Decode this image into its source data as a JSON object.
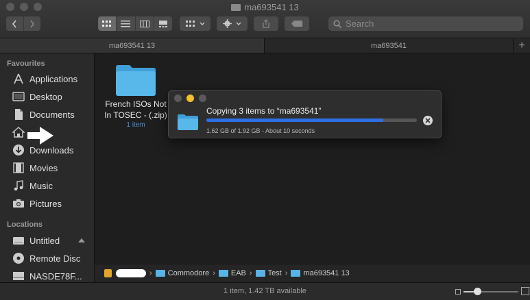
{
  "window": {
    "title": "ma693541 13"
  },
  "toolbar": {
    "search_placeholder": "Search",
    "view_modes": [
      "icon-view",
      "list-view",
      "column-view",
      "gallery-view"
    ],
    "active_view": "icon-view"
  },
  "tabs": [
    {
      "label": "ma693541 13",
      "active": true
    },
    {
      "label": "ma693541",
      "active": false
    }
  ],
  "sidebar": {
    "favourites_label": "Favourites",
    "favourites": [
      {
        "label": "Applications",
        "icon": "applications-icon"
      },
      {
        "label": "Desktop",
        "icon": "desktop-icon"
      },
      {
        "label": "Documents",
        "icon": "documents-icon"
      },
      {
        "label": "",
        "icon": "home-icon"
      },
      {
        "label": "Downloads",
        "icon": "downloads-icon"
      },
      {
        "label": "Movies",
        "icon": "movies-icon"
      },
      {
        "label": "Music",
        "icon": "music-icon"
      },
      {
        "label": "Pictures",
        "icon": "pictures-icon"
      }
    ],
    "locations_label": "Locations",
    "locations": [
      {
        "label": "Untitled",
        "icon": "drive-icon"
      },
      {
        "label": "Remote Disc",
        "icon": "disc-icon"
      },
      {
        "label": "NASDE78F...",
        "icon": "nas-icon"
      }
    ]
  },
  "content": {
    "items": [
      {
        "name_line1": "French ISOs Not",
        "name_line2": "In TOSEC - (.zip)",
        "count": "1 item"
      }
    ]
  },
  "pathbar": {
    "crumbs": [
      "Commodore",
      "EAB",
      "Test",
      "ma693541 13"
    ]
  },
  "status": {
    "text": "1 item, 1.42 TB available",
    "icon_size_fraction": 0.25
  },
  "copy_dialog": {
    "title": "Copying 3 items to “ma693541”",
    "status": "1.62 GB of 1.92 GB - About 10 seconds",
    "progress": 0.84,
    "colors": {
      "close": "#5a5a5a",
      "minimize": "#f5c02a",
      "zoom": "#5a5a5a",
      "progress": "#2f6fe4"
    }
  },
  "colors": {
    "folder": "#58b3e6",
    "accent_blue": "#4a90d9"
  }
}
